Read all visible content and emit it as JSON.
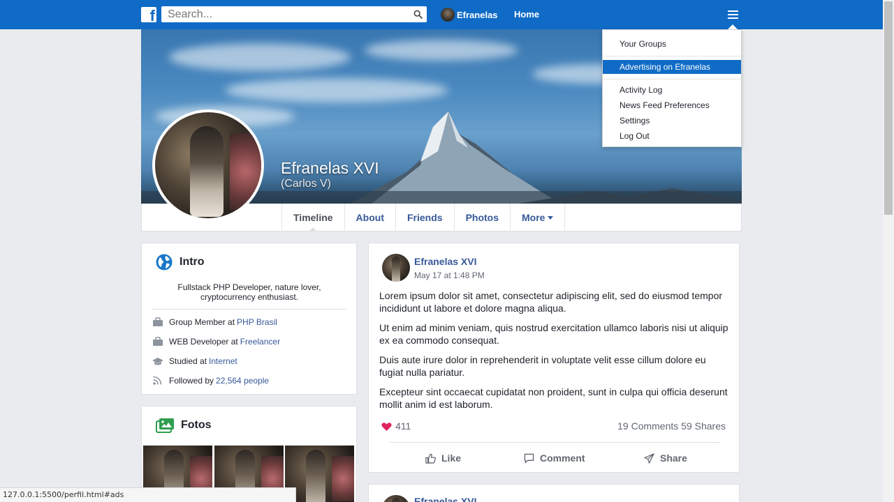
{
  "topbar": {
    "logo": "f",
    "search_placeholder": "Search...",
    "user_name": "Efranelas",
    "home_label": "Home"
  },
  "dropdown": {
    "items": [
      {
        "label": "Your Groups"
      },
      {
        "label": "Advertising on Efranelas"
      },
      {
        "label": "Activity Log"
      },
      {
        "label": "News Feed Preferences"
      },
      {
        "label": "Settings"
      },
      {
        "label": "Log Out"
      }
    ],
    "highlighted_index": 1
  },
  "profile": {
    "name": "Efranelas XVI",
    "subtitle": "(Carlos V)"
  },
  "tabs": [
    {
      "label": "Timeline"
    },
    {
      "label": "About"
    },
    {
      "label": "Friends"
    },
    {
      "label": "Photos"
    },
    {
      "label": "More"
    }
  ],
  "intro": {
    "title": "Intro",
    "bio": "Fullstack PHP Developer, nature lover, cryptocurrency enthusiast.",
    "rows": [
      {
        "text": "Group Member at",
        "link": "PHP Brasil"
      },
      {
        "text": "WEB Developer at",
        "link": "Freelancer"
      },
      {
        "text": "Studied at",
        "link": "Internet"
      },
      {
        "text": "Followed by",
        "link": "22,564 people"
      }
    ]
  },
  "fotos": {
    "title": "Fotos"
  },
  "post": {
    "author": "Efranelas XVI",
    "time": "May 17 at 1:48 PM",
    "paragraphs": [
      "Lorem ipsum dolor sit amet, consectetur adipiscing elit, sed do eiusmod tempor incididunt ut labore et dolore magna aliqua.",
      "Ut enim ad minim veniam, quis nostrud exercitation ullamco laboris nisi ut aliquip ex ea commodo consequat.",
      "Duis aute irure dolor in reprehenderit in voluptate velit esse cillum dolore eu fugiat nulla pariatur.",
      "Excepteur sint occaecat cupidatat non proident, sunt in culpa qui officia deserunt mollit anim id est laborum."
    ],
    "likes": "411",
    "comments": "19 Comments",
    "shares": "59 Shares",
    "actions": {
      "like": "Like",
      "comment": "Comment",
      "share": "Share"
    }
  },
  "post2": {
    "author": "Efranelas XVI"
  },
  "status_bar": {
    "url": "127.0.0.1:5500/perfil.html#ads"
  },
  "colors": {
    "brand": "#0f6bc6",
    "link": "#365899",
    "heart": "#e0245e",
    "globe": "#1877c9",
    "fotos_icon": "#34a853"
  },
  "icons": {
    "logo": "facebook-f-icon",
    "search": "search-icon",
    "menu": "hamburger-icon",
    "intro": "globe-icon",
    "fotos": "images-icon",
    "work": "briefcase-icon",
    "study": "graduation-cap-icon",
    "followers": "rss-icon",
    "likes": "heart-icon",
    "like": "thumbs-up-icon",
    "comment": "comment-icon",
    "share": "paper-plane-icon"
  }
}
